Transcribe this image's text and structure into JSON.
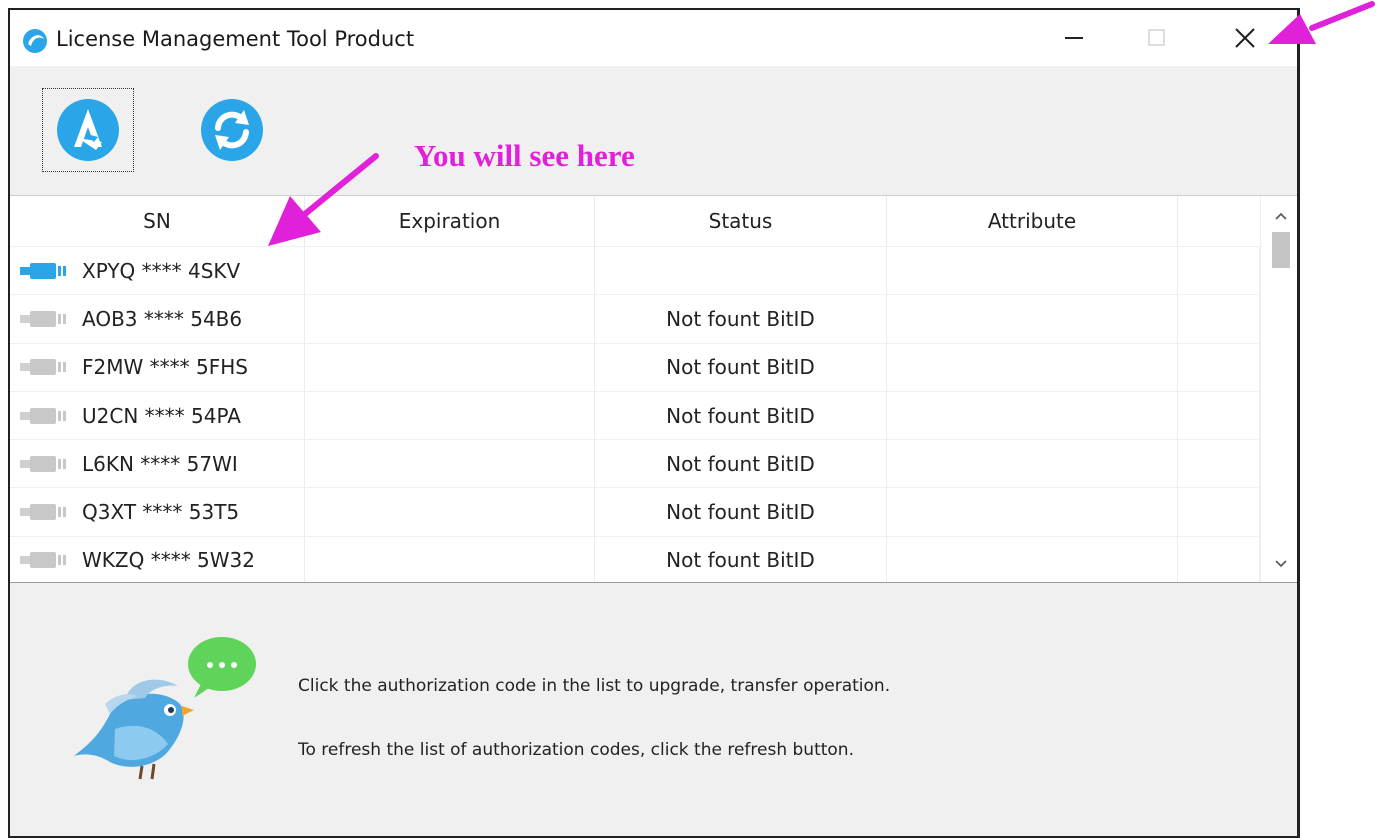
{
  "window": {
    "title": "License Management Tool Product",
    "controls": {
      "minimize": "minimize",
      "maximize": "maximize",
      "close": "close"
    }
  },
  "toolbar": {
    "buttons": [
      {
        "name": "authorize-button",
        "icon": "app-logo-icon",
        "focused": true
      },
      {
        "name": "refresh-button",
        "icon": "refresh-icon",
        "focused": false
      }
    ]
  },
  "annotation": {
    "text": "You will see here",
    "color": "#e021d9"
  },
  "list": {
    "columns": [
      "SN",
      "Expiration",
      "Status",
      "Attribute"
    ],
    "rows": [
      {
        "sn": "XPYQ **** 4SKV",
        "expiration": "",
        "status": "",
        "attribute": "",
        "active": true
      },
      {
        "sn": "AOB3 **** 54B6",
        "expiration": "",
        "status": "Not fount BitID",
        "attribute": "",
        "active": false
      },
      {
        "sn": "F2MW **** 5FHS",
        "expiration": "",
        "status": "Not fount BitID",
        "attribute": "",
        "active": false
      },
      {
        "sn": "U2CN **** 54PA",
        "expiration": "",
        "status": "Not fount BitID",
        "attribute": "",
        "active": false
      },
      {
        "sn": "L6KN **** 57WI",
        "expiration": "",
        "status": "Not fount BitID",
        "attribute": "",
        "active": false
      },
      {
        "sn": "Q3XT **** 53T5",
        "expiration": "",
        "status": "Not fount BitID",
        "attribute": "",
        "active": false
      },
      {
        "sn": "WKZQ **** 5W32",
        "expiration": "",
        "status": "Not fount BitID",
        "attribute": "",
        "active": false
      }
    ]
  },
  "footer": {
    "hint_1": "Click the authorization code in the list to upgrade, transfer operation.",
    "hint_2": "To refresh the list of authorization codes, click the refresh button."
  },
  "colors": {
    "accent": "#2aa6e8",
    "annotation": "#e021d9",
    "inactive_key": "#c8c8c8"
  }
}
